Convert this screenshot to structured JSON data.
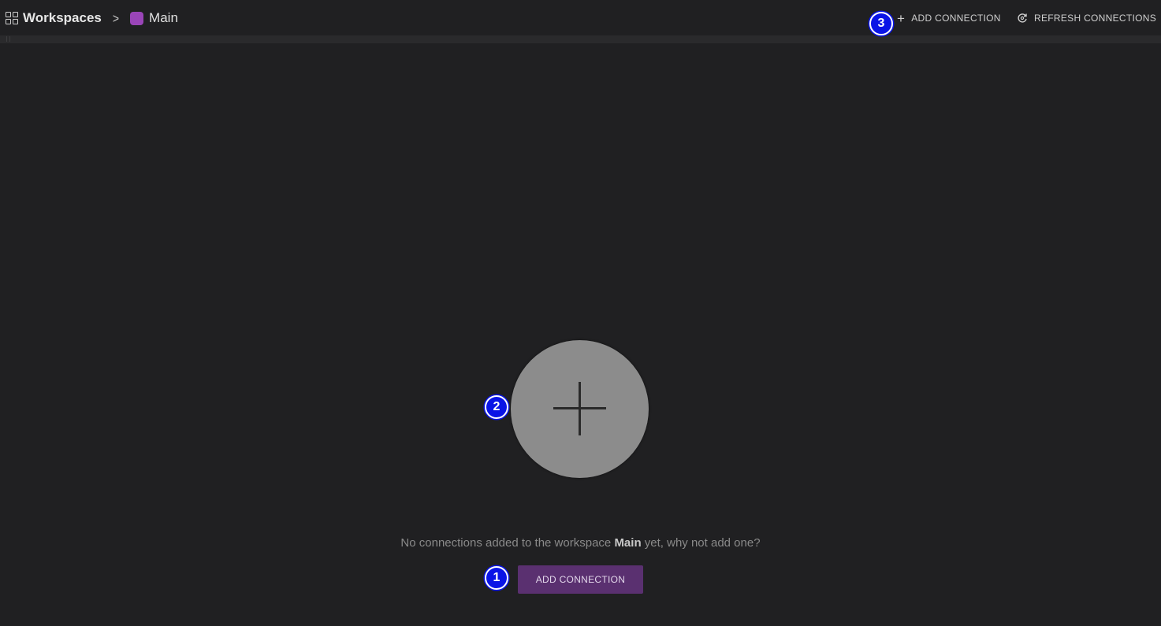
{
  "breadcrumb": {
    "root_label": "Workspaces",
    "separator": ">",
    "workspace_name": "Main",
    "workspace_color": "#9a45b8"
  },
  "toolbar": {
    "add_connection_label": "ADD CONNECTION",
    "add_connection_icon": "plus-icon",
    "refresh_connections_label": "REFRESH CONNECTIONS",
    "refresh_connections_icon": "refresh-icon"
  },
  "empty_state": {
    "icon": "add-circle-icon",
    "message_prefix": "No connections added to the workspace",
    "workspace_name": "Main",
    "message_suffix": "yet, why not add one?",
    "button_label": "ADD CONNECTION"
  },
  "annotations": {
    "marker_1": "1",
    "marker_2": "2",
    "marker_3": "3"
  },
  "colors": {
    "background": "#202022",
    "accent": "#5a3070",
    "marker": "#0a14e6"
  }
}
